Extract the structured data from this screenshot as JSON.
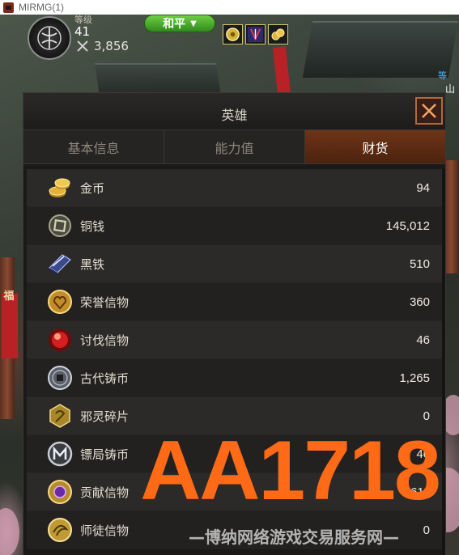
{
  "window": {
    "title": "MIRMG(1)",
    "icon": "mirmg-app-icon"
  },
  "hud": {
    "level_label": "等级",
    "level": "41",
    "power": "3,856",
    "pk_mode": "和平",
    "buff_icons": [
      "coin-aura-icon",
      "sword-buff-icon",
      "gold-coins-icon"
    ]
  },
  "scene": {
    "side_banner_text": "福",
    "npc_tag_a": "等",
    "npc_tag_b": "山"
  },
  "panel": {
    "title": "英雄",
    "close_icon": "close-x-icon",
    "tabs": [
      {
        "label": "基本信息",
        "active": false
      },
      {
        "label": "能力值",
        "active": false
      },
      {
        "label": "财货",
        "active": true
      }
    ],
    "currencies": [
      {
        "name": "金币",
        "value": "94",
        "icon": "gold-coins-icon"
      },
      {
        "name": "铜钱",
        "value": "145,012",
        "icon": "copper-coin-icon"
      },
      {
        "name": "黑铁",
        "value": "510",
        "icon": "black-iron-icon"
      },
      {
        "name": "荣誉信物",
        "value": "360",
        "icon": "honor-token-icon"
      },
      {
        "name": "讨伐信物",
        "value": "46",
        "icon": "subjugation-token-icon"
      },
      {
        "name": "古代铸币",
        "value": "1,265",
        "icon": "ancient-coin-icon"
      },
      {
        "name": "邪灵碎片",
        "value": "0",
        "icon": "evil-spirit-shard-icon"
      },
      {
        "name": "镖局铸币",
        "value": "46",
        "icon": "escort-coin-icon"
      },
      {
        "name": "贡献信物",
        "value": "611",
        "icon": "contribution-token-icon"
      },
      {
        "name": "师徒信物",
        "value": "0",
        "icon": "mentor-token-icon"
      }
    ]
  },
  "watermark": {
    "big": "AA1718",
    "small": "—博纳网络游戏交易服务网—"
  },
  "colors": {
    "active_tab": "#6e3518",
    "mode_green": "#3fa82a",
    "close_border": "#b06a3d",
    "watermark_orange": "#ff6a17"
  }
}
